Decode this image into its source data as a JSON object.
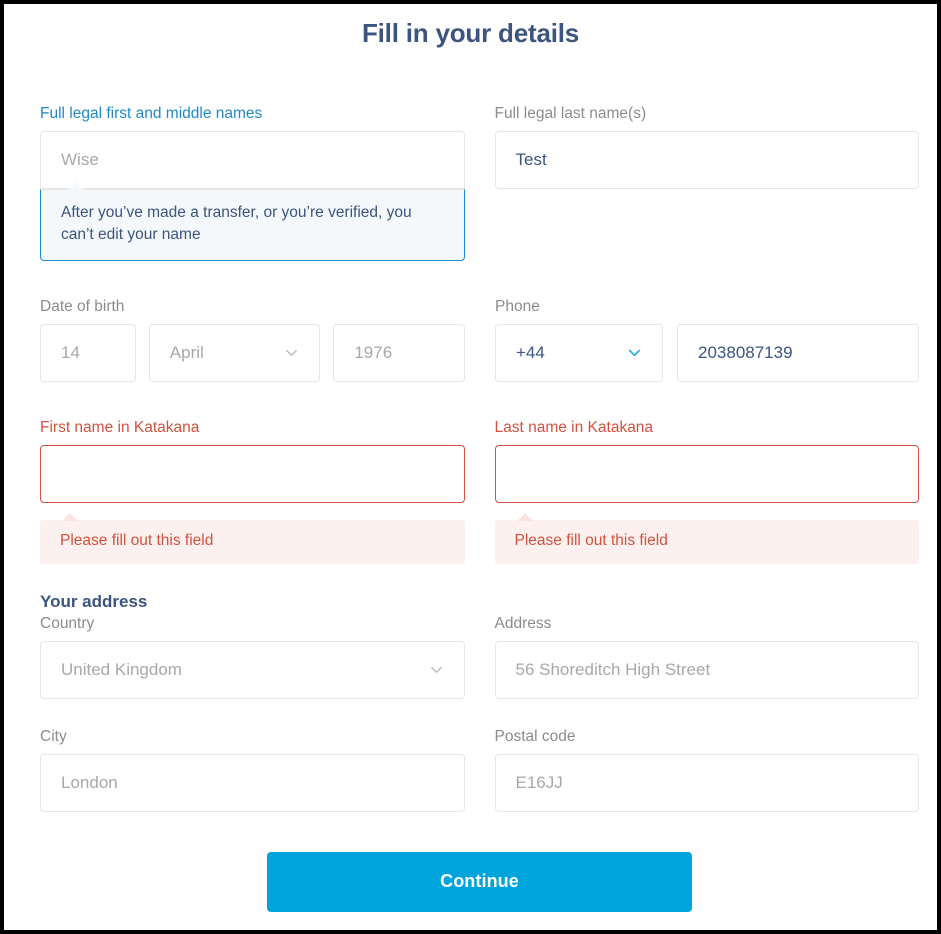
{
  "page": {
    "title": "Fill in your details"
  },
  "colors": {
    "title": "#3b5480",
    "accent_blue": "#2189c9",
    "button_blue": "#00a4dd",
    "error_red": "#d2513f",
    "label_gray": "#8c8c8c",
    "tooltip_bg": "#f4f8fa",
    "error_bg": "#fdf1f0"
  },
  "fields": {
    "first_name": {
      "label": "Full legal first and middle names",
      "placeholder": "Wise",
      "value": "",
      "tooltip": "After you’ve made a transfer, or you’re verified, you can’t edit your name"
    },
    "last_name": {
      "label": "Full legal last name(s)",
      "value": "Test",
      "placeholder": ""
    },
    "date_of_birth": {
      "label": "Date of birth",
      "day_placeholder": "14",
      "month_placeholder": "April",
      "year_placeholder": "1976",
      "day_value": "",
      "month_value": "",
      "year_value": "",
      "chevron_icon": "chevron-down-icon"
    },
    "phone": {
      "label": "Phone",
      "country_code": "+44",
      "number": "2038087139",
      "chevron_icon": "chevron-down-icon"
    },
    "first_name_katakana": {
      "label": "First name in Katakana",
      "value": "",
      "error": "Please fill out this field"
    },
    "last_name_katakana": {
      "label": "Last name in Katakana",
      "value": "",
      "error": "Please fill out this field"
    }
  },
  "address_section": {
    "heading": "Your address",
    "country": {
      "label": "Country",
      "placeholder": "United Kingdom",
      "value": "",
      "chevron_icon": "chevron-down-icon"
    },
    "address": {
      "label": "Address",
      "placeholder": "56 Shoreditch High Street",
      "value": ""
    },
    "city": {
      "label": "City",
      "placeholder": "London",
      "value": ""
    },
    "postal_code": {
      "label": "Postal code",
      "placeholder": "E16JJ",
      "value": ""
    }
  },
  "actions": {
    "continue_label": "Continue"
  }
}
